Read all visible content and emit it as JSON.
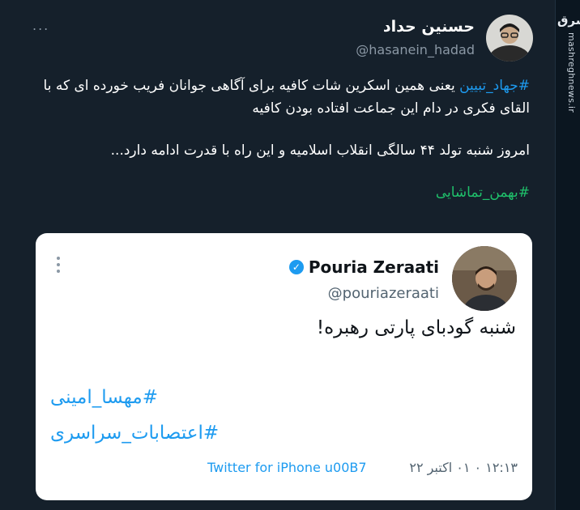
{
  "watermark": {
    "logo": "مشرق",
    "site": "mashreghnews.ir"
  },
  "tweet": {
    "display_name": "حسنین حداد",
    "handle": "@hasanein_hadad",
    "more_label": "...",
    "hashtag_1": "#جهاد_تبیین",
    "line_1_rest": " یعنی همین اسکرین شات کافیه برای آگاهی جوانان فریب خورده ای که با القای فکری در دام این جماعت افتاده بودن کافیه",
    "line_2": "امروز شنبه تولد ۴۴ سالگی انقلاب اسلامیه و این راه با قدرت ادامه دارد...",
    "hashtag_2": "#بهمن_تماشایی"
  },
  "quoted": {
    "name": "Pouria Zeraati",
    "handle": "@pouriazeraati",
    "text": "شنبه گودبای پارتی رهبره!",
    "tag_1": "#مهسا_امینی",
    "tag_2": "#اعتصابات_سراسری",
    "meta_time": "۱۲:۱۳ ۰ ۰۱ اکتبر ۲۲",
    "source": "Twitter for iPhone u00B7"
  },
  "colors": {
    "background": "#15202b",
    "link": "#1d9bf0",
    "hashtag_green": "#1fc16b",
    "card": "#ffffff"
  }
}
